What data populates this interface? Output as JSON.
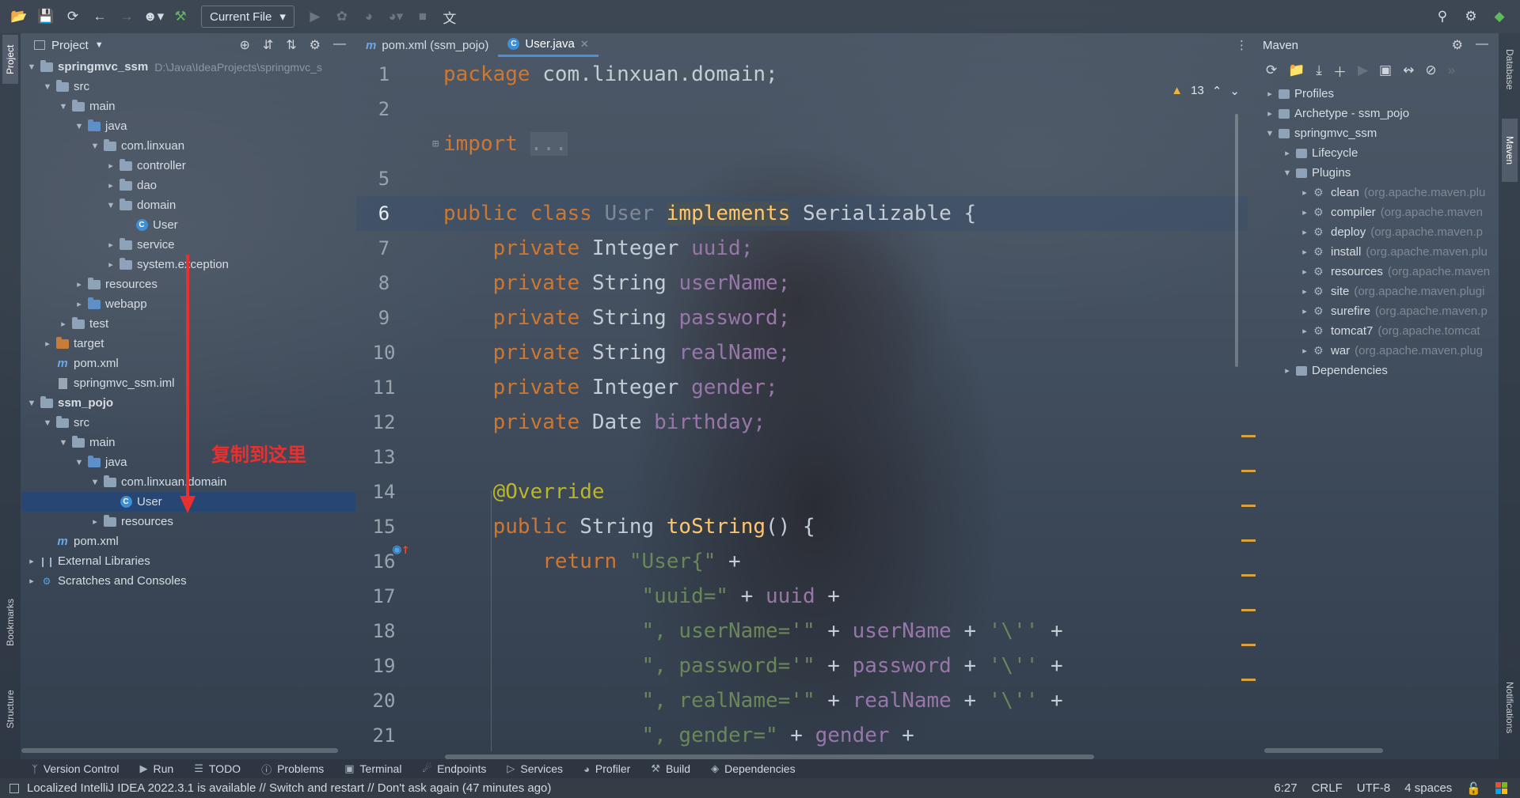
{
  "toolbar": {
    "run_config": "Current File",
    "icons": [
      "open-folder-icon",
      "save-icon",
      "sync-icon",
      "back-icon",
      "forward-icon",
      "user-icon",
      "build-hammer-icon",
      "run-icon",
      "debug-icon",
      "coverage-icon",
      "profile-icon",
      "stop-icon",
      "translate-icon",
      "search-icon",
      "settings-icon",
      "logo-icon"
    ]
  },
  "left_stripe": {
    "project_tab": "Project",
    "bookmarks_tab": "Bookmarks",
    "structure_tab": "Structure"
  },
  "project_panel": {
    "title": "Project",
    "tree": [
      {
        "label": "springmvc_ssm",
        "path": "D:\\Java\\IdeaProjects\\springmvc_s",
        "bold": true
      },
      {
        "label": "src"
      },
      {
        "label": "main"
      },
      {
        "label": "java"
      },
      {
        "label": "com.linxuan"
      },
      {
        "label": "controller"
      },
      {
        "label": "dao"
      },
      {
        "label": "domain"
      },
      {
        "label": "User"
      },
      {
        "label": "service"
      },
      {
        "label": "system.exception"
      },
      {
        "label": "resources"
      },
      {
        "label": "webapp"
      },
      {
        "label": "test"
      },
      {
        "label": "target"
      },
      {
        "label": "pom.xml"
      },
      {
        "label": "springmvc_ssm.iml"
      },
      {
        "label": "ssm_pojo",
        "bold": true
      },
      {
        "label": "src"
      },
      {
        "label": "main"
      },
      {
        "label": "java"
      },
      {
        "label": "com.linxuan.domain"
      },
      {
        "label": "User"
      },
      {
        "label": "resources"
      },
      {
        "label": "pom.xml"
      },
      {
        "label": "External Libraries"
      },
      {
        "label": "Scratches and Consoles"
      }
    ],
    "annotation": "复制到这里"
  },
  "editor": {
    "tabs": [
      {
        "label": "pom.xml (ssm_pojo)",
        "active": false
      },
      {
        "label": "User.java",
        "active": true
      }
    ],
    "warnings_count": "13",
    "line_numbers": [
      "1",
      "2",
      "",
      "5",
      "6",
      "7",
      "8",
      "9",
      "10",
      "11",
      "12",
      "13",
      "14",
      "15",
      "16",
      "17",
      "18",
      "19",
      "20",
      "21"
    ],
    "current_line": "6"
  },
  "code": {
    "l1_kw": "package",
    "l1_pkg": "com.linxuan.domain;",
    "l3_kw": "import",
    "l3_rest": "...",
    "l6_a": "public class",
    "l6_b": "User",
    "l6_c": "implements",
    "l6_d": "Serializable {",
    "private_kw": "private",
    "f1_type": "Integer",
    "f1_name": "uuid;",
    "f2_type": "String",
    "f2_name": "userName;",
    "f3_type": "String",
    "f3_name": "password;",
    "f4_type": "String",
    "f4_name": "realName;",
    "f5_type": "Integer",
    "f5_name": "gender;",
    "f6_type": "Date",
    "f6_name": "birthday;",
    "override": "@Override",
    "m_kw": "public",
    "m_type": "String",
    "m_name": "toString",
    "m_rest": "() {",
    "ret_kw": "return",
    "ret_str": "\"User{\"",
    "ret_plus": " +",
    "s1_str": "\"uuid=\"",
    "s1_rest": " + ",
    "s1_fld": "uuid",
    "s1_end": " +",
    "s2_str": "\", userName='\"",
    "s2_rest": " + ",
    "s2_fld": "userName",
    "s2_mid": " + ",
    "s2_q": "'\\''",
    "s2_end": " +",
    "s3_str": "\", password='\"",
    "s3_rest": " + ",
    "s3_fld": "password",
    "s3_mid": " + ",
    "s3_q": "'\\''",
    "s3_end": " +",
    "s4_str": "\", realName='\"",
    "s4_rest": " + ",
    "s4_fld": "realName",
    "s4_mid": " + ",
    "s4_q": "'\\''",
    "s4_end": " +",
    "s5_str": "\", gender=\"",
    "s5_rest": " + ",
    "s5_fld": "gender",
    "s5_end": " +"
  },
  "maven": {
    "title": "Maven",
    "tree": [
      {
        "label": "Profiles"
      },
      {
        "label": "Archetype - ssm_pojo"
      },
      {
        "label": "springmvc_ssm"
      },
      {
        "label": "Lifecycle"
      },
      {
        "label": "Plugins"
      },
      {
        "label": "clean",
        "hint": "(org.apache.maven.plu"
      },
      {
        "label": "compiler",
        "hint": "(org.apache.maven"
      },
      {
        "label": "deploy",
        "hint": "(org.apache.maven.p"
      },
      {
        "label": "install",
        "hint": "(org.apache.maven.plu"
      },
      {
        "label": "resources",
        "hint": "(org.apache.maven"
      },
      {
        "label": "site",
        "hint": "(org.apache.maven.plugi"
      },
      {
        "label": "surefire",
        "hint": "(org.apache.maven.p"
      },
      {
        "label": "tomcat7",
        "hint": "(org.apache.tomcat"
      },
      {
        "label": "war",
        "hint": "(org.apache.maven.plug"
      },
      {
        "label": "Dependencies"
      }
    ]
  },
  "right_stripe": {
    "database_tab": "Database",
    "maven_tab": "Maven",
    "notifications_tab": "Notifications"
  },
  "bottom_tools": [
    "Version Control",
    "Run",
    "TODO",
    "Problems",
    "Terminal",
    "Endpoints",
    "Services",
    "Profiler",
    "Build",
    "Dependencies"
  ],
  "status": {
    "message": "Localized IntelliJ IDEA 2022.3.1 is available // Switch and restart // Don't ask again (47 minutes ago)",
    "position": "6:27",
    "line_sep": "CRLF",
    "encoding": "UTF-8",
    "indent": "4 spaces"
  },
  "colors": {
    "accent": "#4a8fd8",
    "keyword": "#cc7832",
    "field": "#9876aa",
    "string": "#6a8759",
    "annotation_red": "#e8302e"
  }
}
